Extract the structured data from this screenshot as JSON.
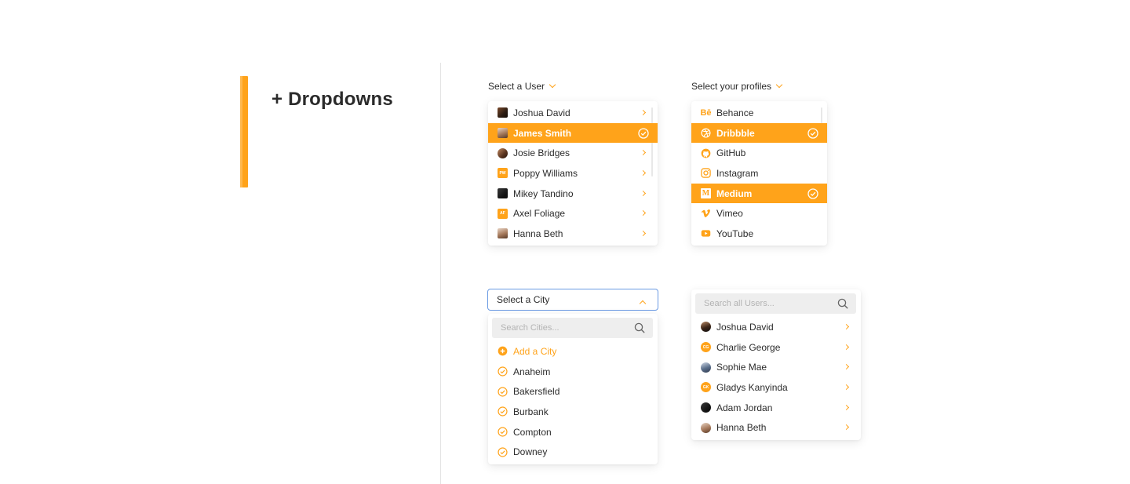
{
  "section": {
    "title": "+ Dropdowns"
  },
  "colors": {
    "accent": "#ffa31a",
    "focus_border": "#6a9ae3",
    "text": "#2b2b2b",
    "placeholder": "#b3b3b3"
  },
  "user_dropdown": {
    "label": "Select a User",
    "items": [
      {
        "name": "Joshua David",
        "avatar": "photo",
        "selected": false
      },
      {
        "name": "James Smith",
        "avatar": "photo",
        "selected": true
      },
      {
        "name": "Josie Bridges",
        "avatar": "photo",
        "selected": false
      },
      {
        "name": "Poppy Williams",
        "avatar": "initials",
        "initials": "PW",
        "selected": false
      },
      {
        "name": "Mikey Tandino",
        "avatar": "photo",
        "selected": false
      },
      {
        "name": "Axel Foliage",
        "avatar": "initials",
        "initials": "AF",
        "selected": false
      },
      {
        "name": "Hanna Beth",
        "avatar": "photo",
        "selected": false
      }
    ]
  },
  "profiles_dropdown": {
    "label": "Select your profiles",
    "items": [
      {
        "name": "Behance",
        "icon": "behance-icon",
        "glyph": "Bē",
        "selected": false
      },
      {
        "name": "Dribbble",
        "icon": "dribbble-icon",
        "selected": true
      },
      {
        "name": "GitHub",
        "icon": "github-icon",
        "selected": false
      },
      {
        "name": "Instagram",
        "icon": "instagram-icon",
        "selected": false
      },
      {
        "name": "Medium",
        "icon": "medium-icon",
        "glyph": "M",
        "selected": true
      },
      {
        "name": "Vimeo",
        "icon": "vimeo-icon",
        "selected": false
      },
      {
        "name": "YouTube",
        "icon": "youtube-icon",
        "selected": false
      }
    ]
  },
  "city_dropdown": {
    "value": "Select a City",
    "search_placeholder": "Search Cities...",
    "add_label": "Add a City",
    "items": [
      "Anaheim",
      "Bakersfield",
      "Burbank",
      "Compton",
      "Downey"
    ]
  },
  "user_search": {
    "placeholder": "Search all Users...",
    "items": [
      {
        "name": "Joshua David",
        "avatar": "photo"
      },
      {
        "name": "Charlie George",
        "avatar": "initials",
        "initials": "CG"
      },
      {
        "name": "Sophie Mae",
        "avatar": "photo"
      },
      {
        "name": "Gladys Kanyinda",
        "avatar": "initials",
        "initials": "GK"
      },
      {
        "name": "Adam Jordan",
        "avatar": "photo"
      },
      {
        "name": "Hanna Beth",
        "avatar": "photo"
      }
    ]
  }
}
